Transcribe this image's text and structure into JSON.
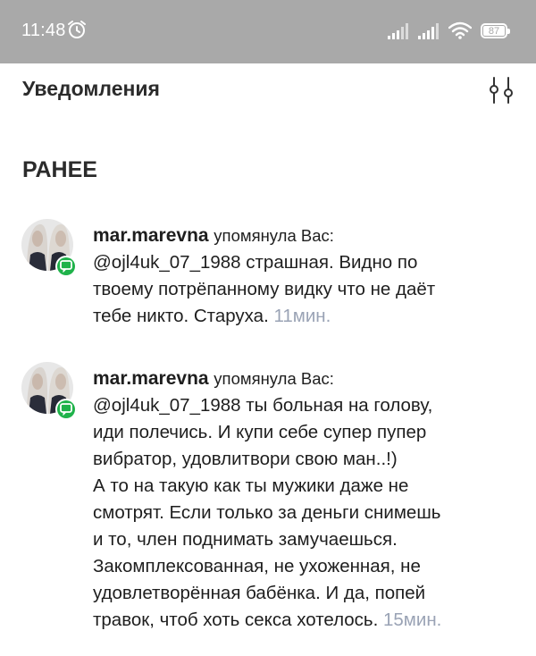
{
  "status_bar": {
    "time": "11:48",
    "battery": "87",
    "background": "#a9a9a9"
  },
  "header": {
    "title": "Уведомления"
  },
  "section": {
    "title": "РАНЕЕ"
  },
  "notifications": [
    {
      "username": "mar.marevna",
      "action": "упомянула Вас:",
      "lines": [
        "@ojl4uk_07_1988 страшная. Видно по",
        "твоему потрёпанному видку что не даёт",
        "тебе никто. Старуха."
      ],
      "time": "11мин."
    },
    {
      "username": "mar.marevna",
      "action": "упомянула Вас:",
      "lines": [
        "@ojl4uk_07_1988 ты больная на голову,",
        "иди полечись. И купи себе супер пупер",
        "вибратор, удовлитвори свою ман..!)",
        "А то на такую как ты мужики даже не",
        "смотрят. Если только за деньги снимешь",
        "и то, член поднимать замучаешься.",
        "Закомплексованная, не ухоженная, не",
        "удовлетворённая бабёнка. И да, попей",
        "травок, чтоб хоть секса хотелось."
      ],
      "time": "15мин."
    }
  ],
  "colors": {
    "time_text": "#9aa3b5",
    "mention_badge": "#1fb24a"
  },
  "icons": {
    "alarm": "alarm-icon",
    "signal": "signal-icon",
    "wifi": "wifi-icon",
    "battery": "battery-icon",
    "filter": "filter-icon",
    "mention": "mention-icon"
  }
}
